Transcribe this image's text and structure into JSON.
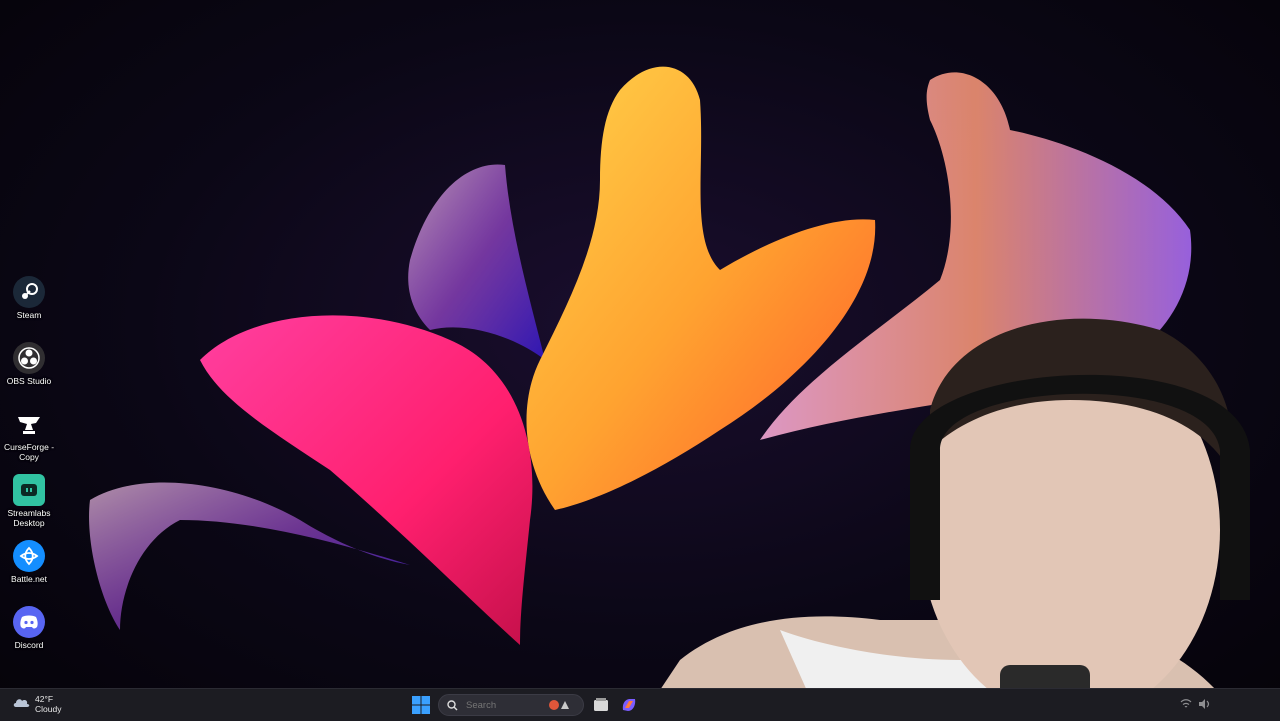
{
  "desktop": {
    "icons": [
      {
        "label": "Steam",
        "icon": "steam-icon"
      },
      {
        "label": "OBS Studio",
        "icon": "obs-icon"
      },
      {
        "label": "CurseForge - Copy",
        "icon": "curseforge-icon"
      },
      {
        "label": "Streamlabs Desktop",
        "icon": "streamlabs-icon"
      },
      {
        "label": "Battle.net",
        "icon": "battlenet-icon"
      },
      {
        "label": "Discord",
        "icon": "discord-icon"
      }
    ]
  },
  "taskbar": {
    "weather": {
      "temp": "42°F",
      "condition": "Cloudy",
      "icon": "cloud-icon"
    },
    "search": {
      "placeholder": "Search"
    },
    "apps": [
      "start-icon",
      "file-explorer-icon",
      "copilot-icon"
    ]
  },
  "colors": {
    "background": "#0b0716",
    "taskbar": "#1c1c22",
    "accent_pink": "#ff2d7a",
    "accent_orange": "#ffa330",
    "windows_blue": "#1e90ff"
  }
}
